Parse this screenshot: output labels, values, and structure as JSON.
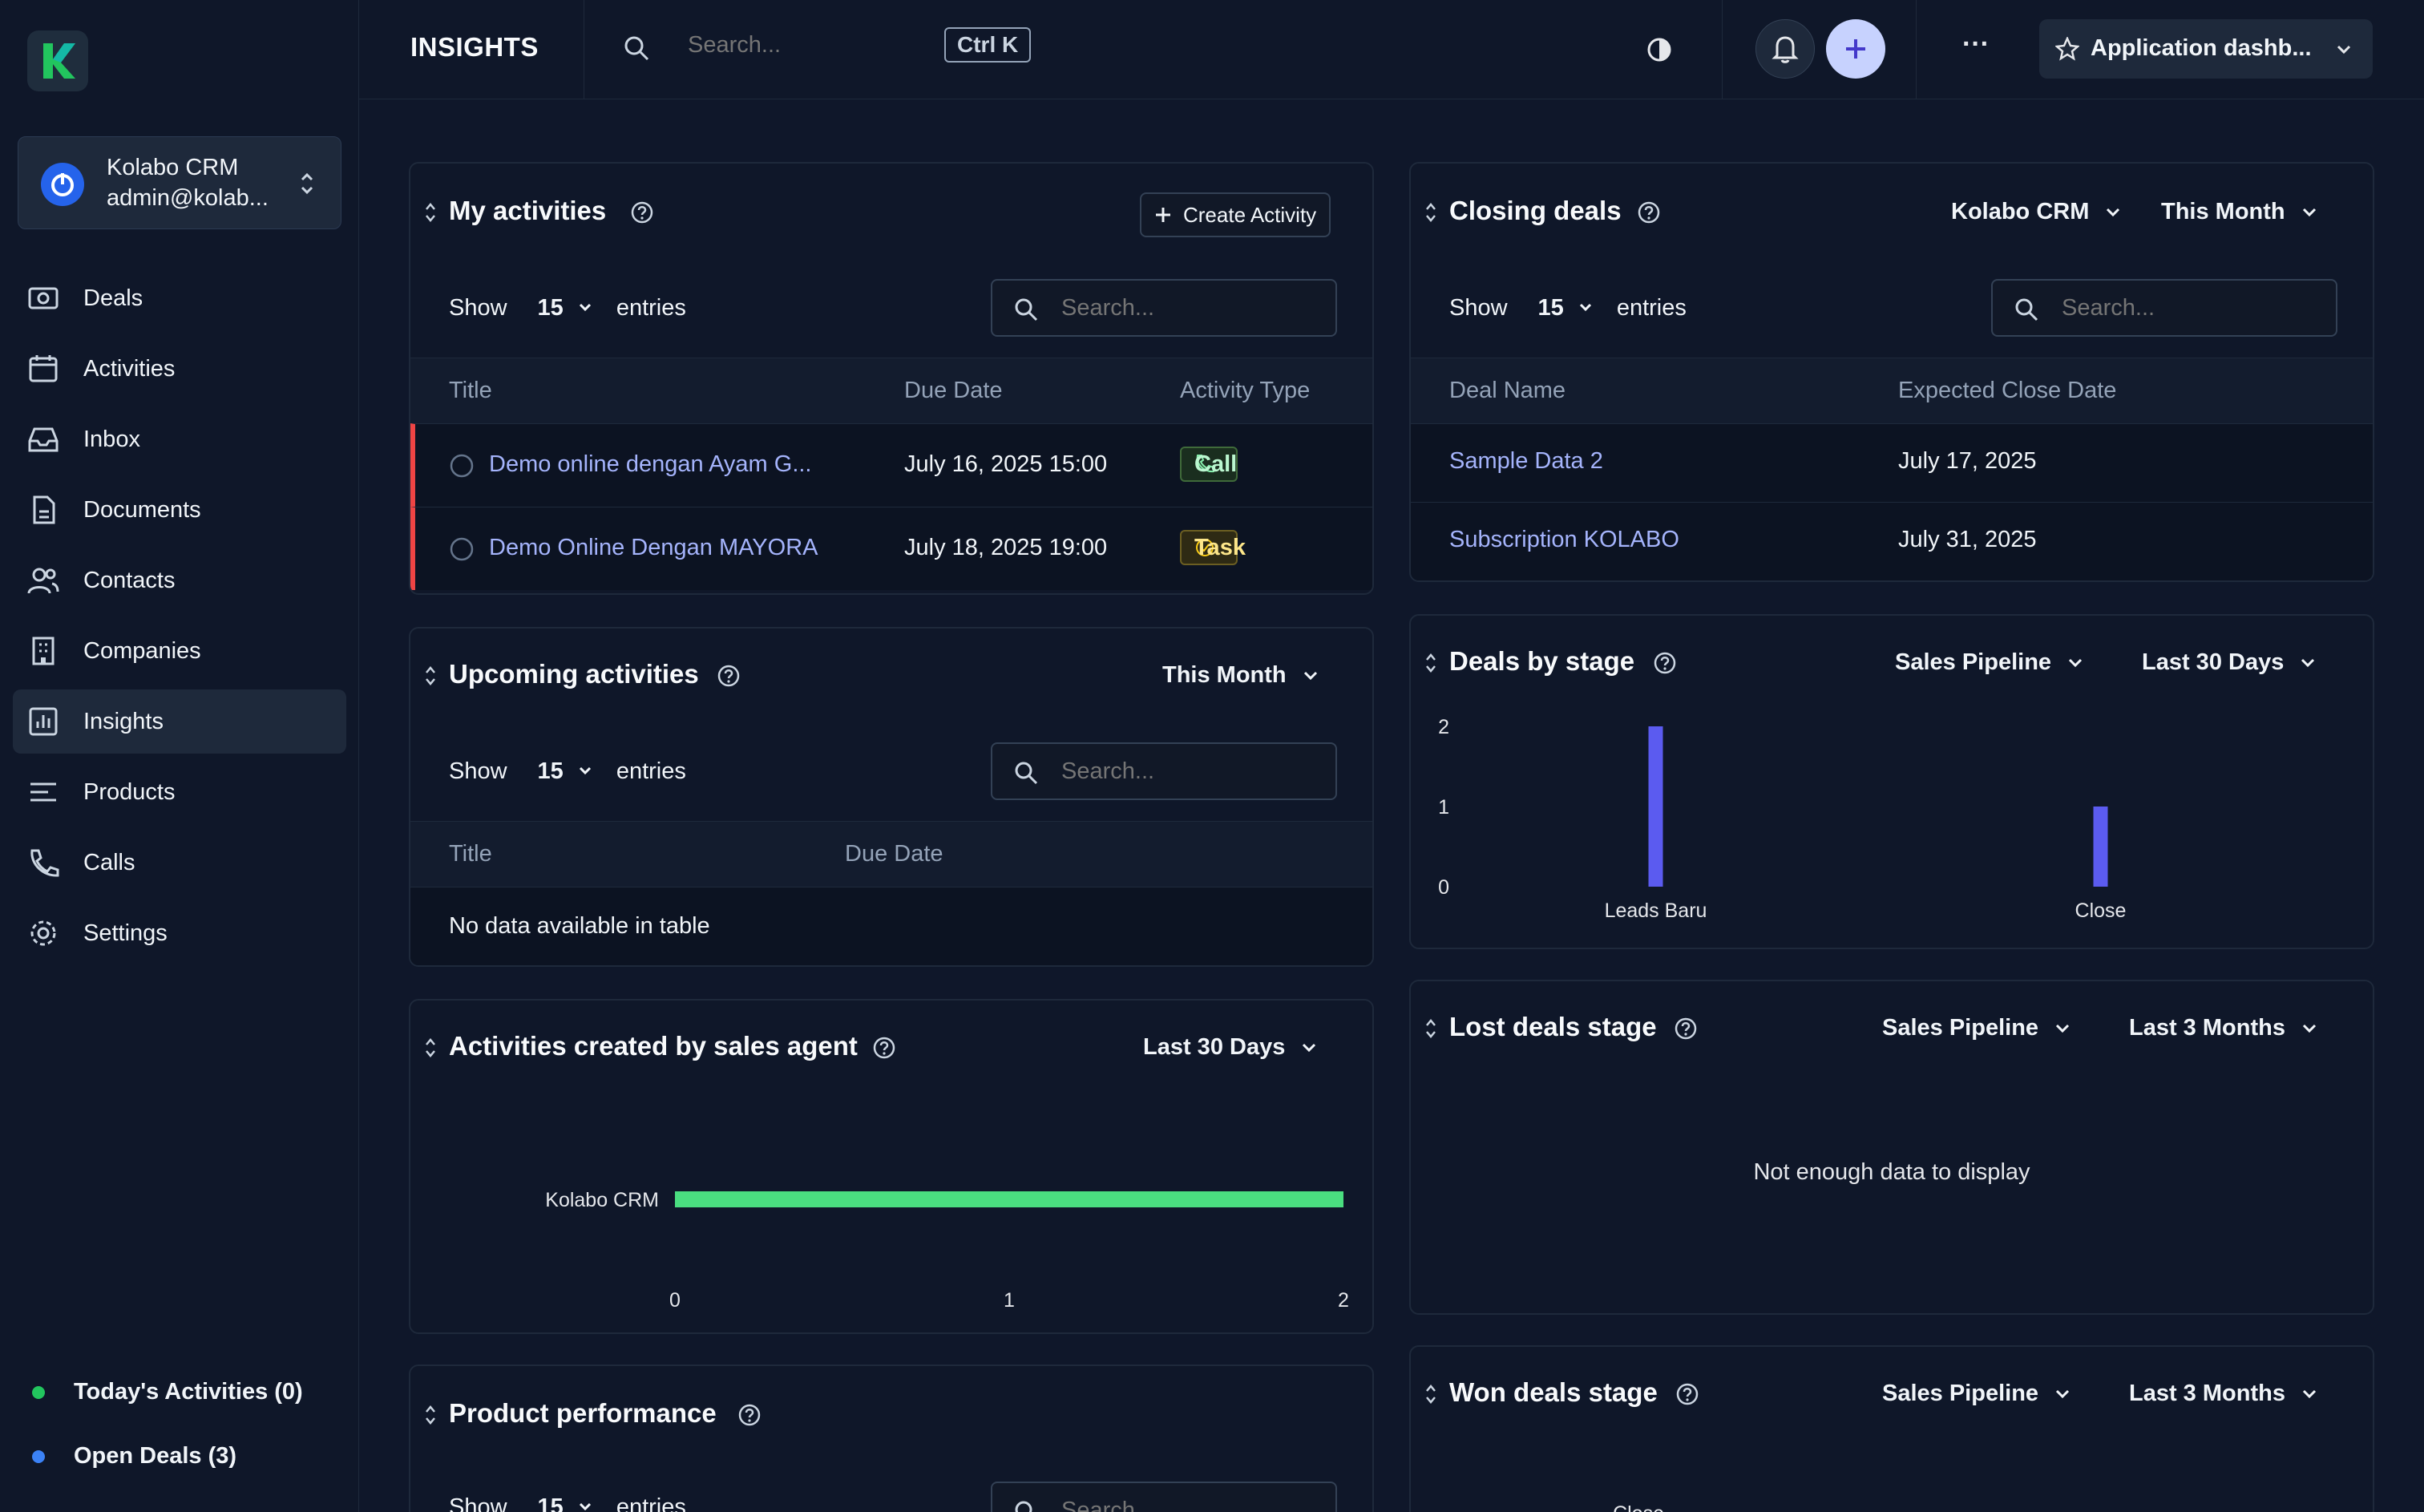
{
  "topbar": {
    "page_title": "INSIGHTS",
    "search_placeholder": "Search...",
    "shortcut": "Ctrl K",
    "app_switcher": "Application dashb..."
  },
  "account": {
    "name": "Kolabo CRM",
    "email": "admin@kolab..."
  },
  "nav": [
    {
      "label": "Deals",
      "icon": "deals-icon"
    },
    {
      "label": "Activities",
      "icon": "calendar-icon"
    },
    {
      "label": "Inbox",
      "icon": "inbox-icon"
    },
    {
      "label": "Documents",
      "icon": "document-icon"
    },
    {
      "label": "Contacts",
      "icon": "contacts-icon"
    },
    {
      "label": "Companies",
      "icon": "building-icon"
    },
    {
      "label": "Insights",
      "icon": "chart-icon",
      "active": true
    },
    {
      "label": "Products",
      "icon": "list-icon"
    },
    {
      "label": "Calls",
      "icon": "phone-icon"
    },
    {
      "label": "Settings",
      "icon": "gear-icon"
    }
  ],
  "footer": {
    "today": "Today's Activities (0)",
    "today_color": "#22c55e",
    "open_deals": "Open Deals (3)",
    "open_color": "#3b82f6"
  },
  "common": {
    "show": "Show",
    "entries": "entries",
    "entries_count": "15",
    "search_placeholder": "Search..."
  },
  "my_activities": {
    "title": "My activities",
    "create_button": "Create Activity",
    "columns": [
      "Title",
      "Due Date",
      "Activity Type"
    ],
    "rows": [
      {
        "title": "Demo online dengan Ayam G...",
        "due": "July 16, 2025 15:00",
        "type": "Call"
      },
      {
        "title": "Demo Online Dengan MAYORA",
        "due": "July 18, 2025 19:00",
        "type": "Task"
      }
    ]
  },
  "upcoming": {
    "title": "Upcoming activities",
    "period": "This Month",
    "columns": [
      "Title",
      "Due Date"
    ],
    "empty": "No data available in table"
  },
  "by_agent": {
    "title": "Activities created by sales agent",
    "period": "Last 30 Days"
  },
  "product_perf": {
    "title": "Product performance"
  },
  "closing_deals": {
    "title": "Closing deals",
    "filter": "Kolabo CRM",
    "period": "This Month",
    "columns": [
      "Deal Name",
      "Expected Close Date"
    ],
    "rows": [
      {
        "name": "Sample Data 2",
        "date": "July 17, 2025"
      },
      {
        "name": "Subscription KOLABO",
        "date": "July 31, 2025"
      }
    ]
  },
  "deals_by_stage": {
    "title": "Deals by stage",
    "pipeline": "Sales Pipeline",
    "period": "Last 30 Days"
  },
  "lost_deals": {
    "title": "Lost deals stage",
    "pipeline": "Sales Pipeline",
    "period": "Last 3 Months",
    "empty": "Not enough data to display"
  },
  "won_deals": {
    "title": "Won deals stage",
    "pipeline": "Sales Pipeline",
    "period": "Last 3 Months"
  },
  "chart_data": [
    {
      "type": "bar",
      "categories": [
        "Leads Baru",
        "Close"
      ],
      "values": [
        2,
        1
      ],
      "yticks": [
        "0",
        "1",
        "2"
      ],
      "ylim": [
        0,
        2
      ],
      "color": "#5b5bf0"
    },
    {
      "type": "bar",
      "orientation": "horizontal",
      "categories": [
        "Kolabo CRM"
      ],
      "values": [
        2
      ],
      "xticks": [
        "0",
        "1",
        "2"
      ],
      "xlim": [
        0,
        2
      ],
      "color": "#4ade80"
    },
    {
      "type": "bar",
      "orientation": "horizontal",
      "categories": [
        "Close"
      ],
      "color": "#4ade80"
    }
  ]
}
